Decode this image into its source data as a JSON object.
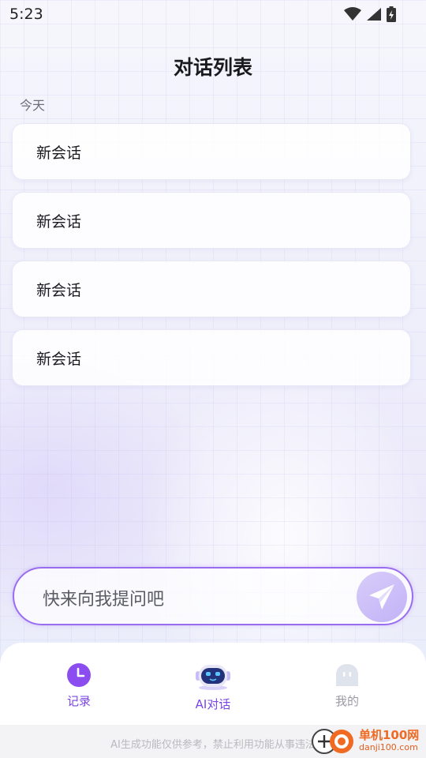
{
  "status_bar": {
    "time": "5:23"
  },
  "header": {
    "title": "对话列表"
  },
  "section": {
    "label": "今天"
  },
  "conversations": [
    {
      "title": "新会话"
    },
    {
      "title": "新会话"
    },
    {
      "title": "新会话"
    },
    {
      "title": "新会话"
    }
  ],
  "input": {
    "placeholder": "快来向我提问吧"
  },
  "nav": {
    "items": [
      {
        "label": "记录",
        "icon": "clock-icon",
        "color": "#8b4df0"
      },
      {
        "label": "AI对话",
        "icon": "robot-icon",
        "color": "#7a45e6"
      },
      {
        "label": "我的",
        "icon": "profile-icon",
        "color": "#9a9aa4"
      }
    ]
  },
  "footer": {
    "disclaimer": "AI生成功能仅供参考，禁止利用功能从事违法"
  },
  "watermark": {
    "name": "单机100网",
    "url": "danji100.com"
  },
  "colors": {
    "accent": "#9a6df0",
    "send_bg": "#c8b8f8"
  }
}
